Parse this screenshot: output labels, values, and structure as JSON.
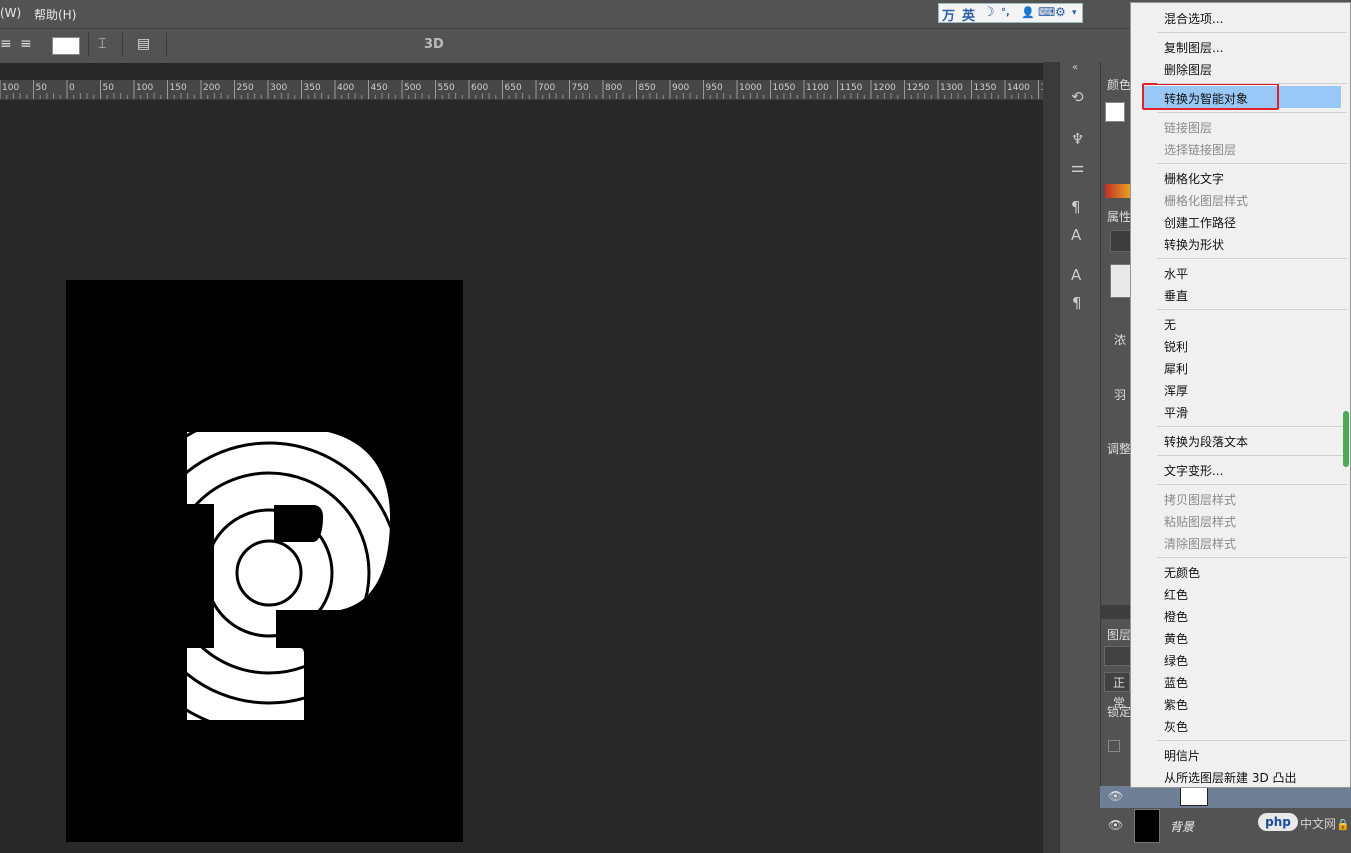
{
  "menubar": {
    "window_label": "(W)",
    "help_label": "帮助(H)"
  },
  "ime": {
    "chars": [
      "万",
      "英",
      "☽",
      "°,",
      "👤",
      "⌨",
      "⚙",
      "▾"
    ]
  },
  "optbar": {
    "label_3d": "3D"
  },
  "ruler": {
    "ticks": [
      "100",
      "50",
      "0",
      "50",
      "100",
      "150",
      "200",
      "250",
      "300",
      "350",
      "400",
      "450",
      "500",
      "550",
      "600",
      "650",
      "700",
      "750",
      "800",
      "850",
      "900",
      "950",
      "1000",
      "1050",
      "1100",
      "1150",
      "1200",
      "1250",
      "1300",
      "1350",
      "1400",
      "1"
    ]
  },
  "panels": {
    "color": "颜色",
    "properties": "属性",
    "opacity_short": "浓",
    "feather": "羽",
    "adjust": "调整",
    "layers": "图层",
    "normal": "正常",
    "lock": "锁定",
    "bg_layer": "背景"
  },
  "context_menu": {
    "items": [
      {
        "label": "混合选项...",
        "disabled": false
      },
      {
        "label": "复制图层...",
        "disabled": false
      },
      {
        "label": "删除图层",
        "disabled": false
      },
      {
        "label": "转换为智能对象",
        "disabled": false,
        "highlight": true
      },
      {
        "label": "链接图层",
        "disabled": true
      },
      {
        "label": "选择链接图层",
        "disabled": true
      },
      {
        "label": "栅格化文字",
        "disabled": false
      },
      {
        "label": "栅格化图层样式",
        "disabled": true
      },
      {
        "label": "创建工作路径",
        "disabled": false
      },
      {
        "label": "转换为形状",
        "disabled": false
      },
      {
        "label": "水平",
        "disabled": false
      },
      {
        "label": "垂直",
        "disabled": false
      },
      {
        "label": "无",
        "disabled": false
      },
      {
        "label": "锐利",
        "disabled": false
      },
      {
        "label": "犀利",
        "disabled": false
      },
      {
        "label": "浑厚",
        "disabled": false
      },
      {
        "label": "平滑",
        "disabled": false
      },
      {
        "label": "转换为段落文本",
        "disabled": false
      },
      {
        "label": "文字变形...",
        "disabled": false
      },
      {
        "label": "拷贝图层样式",
        "disabled": true
      },
      {
        "label": "粘贴图层样式",
        "disabled": true
      },
      {
        "label": "清除图层样式",
        "disabled": true
      },
      {
        "label": "无颜色",
        "disabled": false
      },
      {
        "label": "红色",
        "disabled": false
      },
      {
        "label": "橙色",
        "disabled": false
      },
      {
        "label": "黄色",
        "disabled": false
      },
      {
        "label": "绿色",
        "disabled": false
      },
      {
        "label": "蓝色",
        "disabled": false
      },
      {
        "label": "紫色",
        "disabled": false
      },
      {
        "label": "灰色",
        "disabled": false
      },
      {
        "label": "明信片",
        "disabled": false
      },
      {
        "label": "从所选图层新建 3D 凸出",
        "disabled": false
      }
    ]
  },
  "watermark": {
    "badge": "php",
    "text": "中文网"
  },
  "colors": {
    "highlight": "#99c8f6",
    "highlight_border": "#e0222a",
    "app_bg": "#282828",
    "toolbar": "#535353"
  }
}
